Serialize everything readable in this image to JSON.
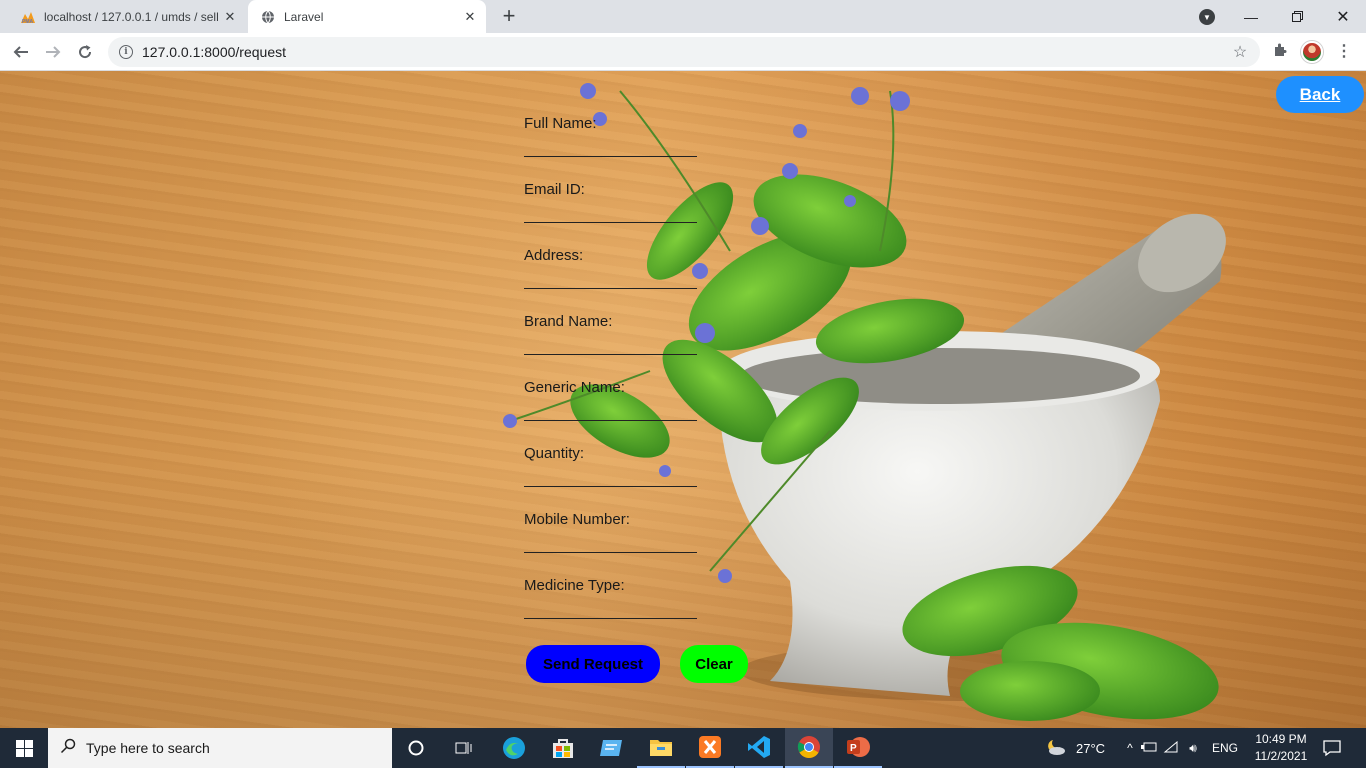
{
  "browser": {
    "tabs": [
      {
        "title": "localhost / 127.0.0.1 / umds / sell",
        "favicon": "phpmyadmin-icon",
        "active": false
      },
      {
        "title": "Laravel",
        "favicon": "globe-icon",
        "active": true
      }
    ],
    "url": "127.0.0.1:8000/request"
  },
  "page": {
    "back_label": "Back",
    "fields": [
      {
        "label": "Full Name:",
        "value": ""
      },
      {
        "label": "Email ID:",
        "value": ""
      },
      {
        "label": "Address:",
        "value": ""
      },
      {
        "label": "Brand Name:",
        "value": ""
      },
      {
        "label": "Generic Name:",
        "value": ""
      },
      {
        "label": "Quantity:",
        "value": ""
      },
      {
        "label": "Mobile Number:",
        "value": ""
      },
      {
        "label": "Medicine Type:",
        "value": ""
      }
    ],
    "send_label": "Send Request",
    "clear_label": "Clear",
    "colors": {
      "back": "#1e90ff",
      "send": "#0000ff",
      "clear": "#00ff00"
    }
  },
  "taskbar": {
    "search_placeholder": "Type here to search",
    "weather": "27°C",
    "language": "ENG",
    "time": "10:49 PM",
    "date": "11/2/2021"
  }
}
